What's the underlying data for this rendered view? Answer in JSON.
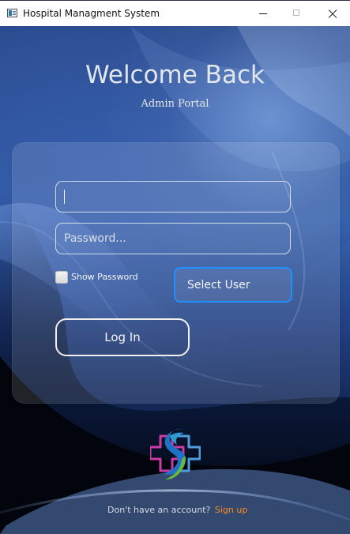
{
  "window": {
    "title": "Hospital Managment System",
    "icons": {
      "app": "window-app-icon",
      "minimize": "minimize-icon",
      "maximize": "maximize-icon",
      "close": "close-icon"
    }
  },
  "hero": {
    "title": "Welcome Back",
    "subtitle": "Admin Portal"
  },
  "form": {
    "username": {
      "value": "",
      "placeholder": ""
    },
    "password": {
      "value": "",
      "placeholder": "Password..."
    },
    "show_password": {
      "label": "Show Password",
      "checked": false
    },
    "select_user": {
      "selected": "Select User"
    },
    "login_button": {
      "label": "Log In"
    }
  },
  "footer": {
    "prompt": "Don't have an account?",
    "link_text": "Sign up"
  },
  "colors": {
    "background": "#2f5aa6",
    "accent": "#1f91ff",
    "signup": "#ff8a1f",
    "text": "#e3e6ea"
  }
}
